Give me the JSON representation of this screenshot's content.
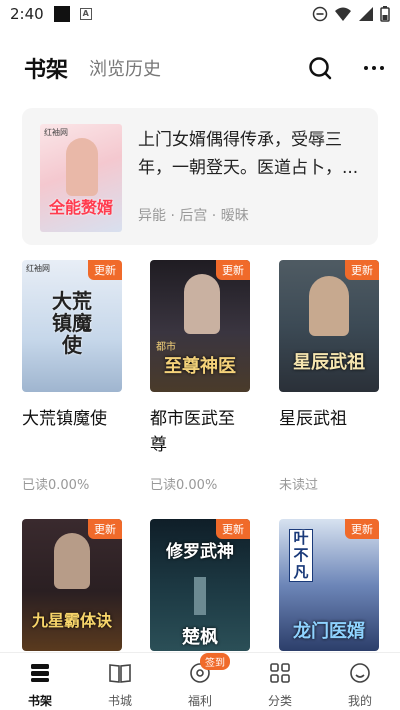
{
  "status_bar": {
    "time": "2:40",
    "a_label": "A"
  },
  "header": {
    "tab_shelf": "书架",
    "tab_history": "浏览历史"
  },
  "featured": {
    "description": "上门女婿偶得传承，受辱三年，一朝登天。医道占卜，...",
    "tags": "异能 · 后宫 · 暧昧",
    "cover_title": "全能赘婿",
    "cover_brand": "红袖网"
  },
  "badge_label": "更新",
  "books": [
    {
      "title": "大荒镇魔使",
      "progress": "已读0.00%",
      "cover_text": "大荒镇魔使",
      "cover_brand": "红袖网",
      "color": "#c9d6e8"
    },
    {
      "title": "都市医武至尊",
      "progress": "已读0.00%",
      "cover_text": "至尊神医",
      "cover_brand": "都市",
      "color": "#2e2a30"
    },
    {
      "title": "星辰武祖",
      "progress": "未读过",
      "cover_text": "星辰武祖",
      "color": "#3c4a55"
    },
    {
      "title": "",
      "progress": "",
      "cover_text": "九星霸体诀",
      "color": "#2a1f22"
    },
    {
      "title": "",
      "progress": "",
      "cover_text": "楚枫",
      "cover_top": "修罗武神",
      "color": "#1d3a44"
    },
    {
      "title": "",
      "progress": "",
      "cover_text": "龙门医婿",
      "cover_top": "叶不凡",
      "color": "#2c3e6a"
    }
  ],
  "tabbar": {
    "shelf": "书架",
    "store": "书城",
    "welfare": "福利",
    "welfare_badge": "签到",
    "category": "分类",
    "mine": "我的"
  },
  "colors": {
    "accent": "#f06a2a"
  }
}
